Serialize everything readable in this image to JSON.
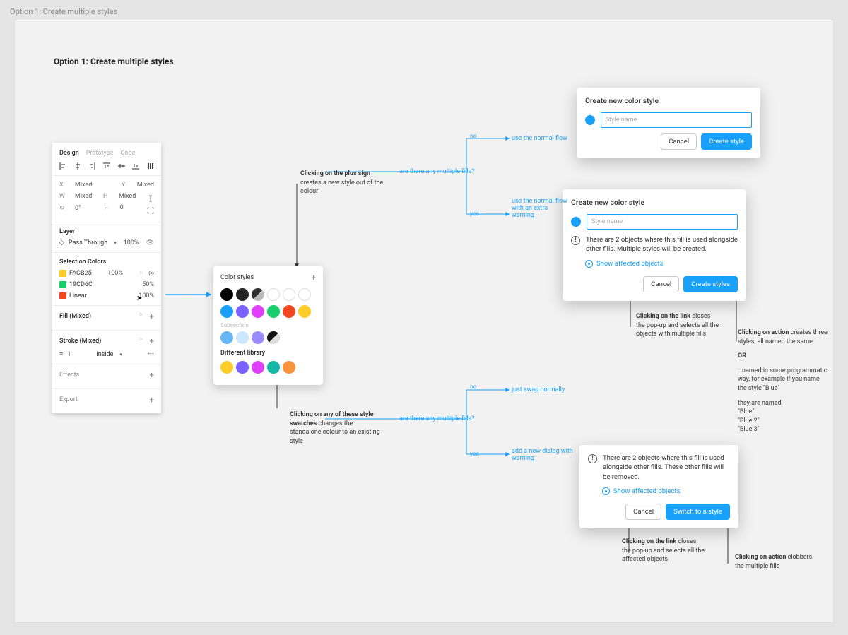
{
  "canvas_tab": "Option 1: Create multiple styles",
  "artboard_title": "Option 1: Create multiple styles",
  "inspector": {
    "tabs": {
      "design": "Design",
      "prototype": "Prototype",
      "code": "Code"
    },
    "pos": {
      "x_label": "X",
      "x_val": "Mixed",
      "y_label": "Y",
      "y_val": "Mixed",
      "w_label": "W",
      "w_val": "Mixed",
      "h_label": "H",
      "h_val": "Mixed",
      "rot_label": "↻",
      "rot_val": "0°",
      "rad_label": "⌐",
      "rad_val": "0"
    },
    "layer": {
      "title": "Layer",
      "mode": "Pass Through",
      "opacity": "100%"
    },
    "selection": {
      "title": "Selection Colors",
      "rows": [
        {
          "name": "FACB25",
          "opacity": "100%",
          "color": "#FACB25"
        },
        {
          "name": "19CD6C",
          "opacity": "50%",
          "color": "#19CD6C"
        },
        {
          "name": "Linear",
          "opacity": "100%",
          "color": "#F24822"
        }
      ]
    },
    "fill": {
      "title": "Fill (Mixed)"
    },
    "stroke": {
      "title": "Stroke (Mixed)",
      "width": "1",
      "align": "Inside"
    },
    "effects": {
      "title": "Effects"
    },
    "export": {
      "title": "Export"
    }
  },
  "popover": {
    "title": "Color styles",
    "subsection": "Subsection",
    "library": "Different library",
    "row1": [
      "#000000",
      "#222222",
      "#444444",
      "outline",
      "outline",
      "outline"
    ],
    "row2": [
      "#18A0FB",
      "#7B61FF",
      "#E040FB",
      "#19CD6C",
      "#F24822",
      "#FFCD29"
    ],
    "sub": [
      "#67B7F7",
      "#CDE7FF",
      "#9A8CFF",
      "#111111"
    ],
    "lib": [
      "#FFCD29",
      "#7B61FF",
      "#E040FB",
      "#14B8A6",
      "#FB923C"
    ]
  },
  "dlg_simple": {
    "title": "Create new color style",
    "placeholder": "Style name",
    "cancel": "Cancel",
    "create": "Create style"
  },
  "dlg_multi": {
    "title": "Create new color style",
    "placeholder": "Style name",
    "warning": "There are 2 objects where this fill is used alongside other fills. Multiple styles will be created.",
    "show": "Show affected objects",
    "cancel": "Cancel",
    "create": "Create styles"
  },
  "dlg_switch": {
    "warning": "There are 2 objects where this fill is used alongside other fills. These other fills will be removed.",
    "show": "Show affected objects",
    "cancel": "Cancel",
    "switch": "Switch to a style"
  },
  "flow": {
    "q1": "are there any multiple fills?",
    "q2": "are there any multiple fills?",
    "no": "no",
    "yes": "yes",
    "use_normal": "use the normal flow",
    "use_normal_warn": "use the normal flow with an extra warning",
    "just_swap": "just swap normally",
    "add_dialog": "add a new dialog with warning"
  },
  "notes": {
    "plus": {
      "bold": "Clicking on the plus sign",
      "rest": " creates a new style out of the colour"
    },
    "swatch": {
      "bold": "Clicking on any of these style swatches",
      "rest": " changes the standalone colour to an existing style"
    },
    "link1": {
      "bold": "Clicking on the link",
      "rest": " closes the pop-up and selects all the objects with multiple fills"
    },
    "action1a": {
      "bold": "Clicking on action",
      "rest": " creates three styles, all named the same"
    },
    "action1_or": "OR",
    "action1b": "…named in some programmatic way, for example if you name the style \"Blue\"",
    "action1c": "they are named",
    "action1d": "\"Blue\"",
    "action1e": "\"Blue 2\"",
    "action1f": "\"Blue 3\"",
    "link2": {
      "bold": "Clicking on the link",
      "rest": " closes the pop-up and selects all the affected objects"
    },
    "action2": {
      "bold": "Clicking on action",
      "rest": " clobbers the multiple fills"
    }
  }
}
